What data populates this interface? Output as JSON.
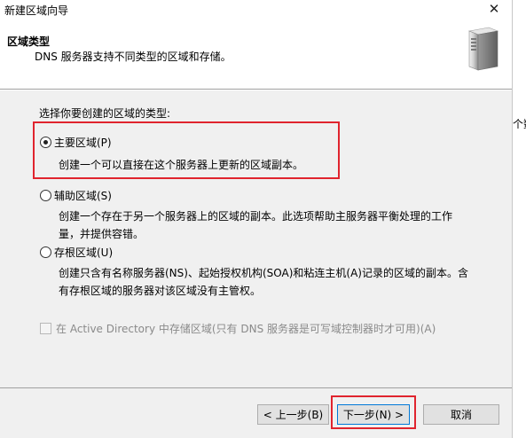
{
  "window": {
    "title": "新建区域向导",
    "close_glyph": "✕"
  },
  "background_window": {
    "partial_text": "个数"
  },
  "header": {
    "title": "区域类型",
    "subtitle": "DNS 服务器支持不同类型的区域和存储。",
    "icon": "server-tower-icon"
  },
  "content": {
    "prompt": "选择你要创建的区域的类型:",
    "options": [
      {
        "label": "主要区域(P)",
        "checked": true,
        "description": [
          "创建一个可以直接在这个服务器上更新的区域副本。"
        ]
      },
      {
        "label": "辅助区域(S)",
        "checked": false,
        "description": [
          "创建一个存在于另一个服务器上的区域的副本。此选项帮助主服务器平衡处理的工作",
          "量，并提供容错。"
        ]
      },
      {
        "label": "存根区域(U)",
        "checked": false,
        "description": [
          "创建只含有名称服务器(NS)、起始授权机构(SOA)和粘连主机(A)记录的区域的副本。含",
          "有存根区域的服务器对该区域没有主管权。"
        ]
      }
    ],
    "ad_checkbox": {
      "label": "在 Active Directory 中存储区域(只有 DNS 服务器是可写域控制器时才可用)(A)",
      "checked": false,
      "enabled": false
    }
  },
  "buttons": {
    "back": "< 上一步(B)",
    "next": "下一步(N) >",
    "cancel": "取消"
  },
  "colors": {
    "highlight": "#e0242e",
    "panel_bg": "#f0f0f0",
    "default_button_border": "#0078d7"
  }
}
